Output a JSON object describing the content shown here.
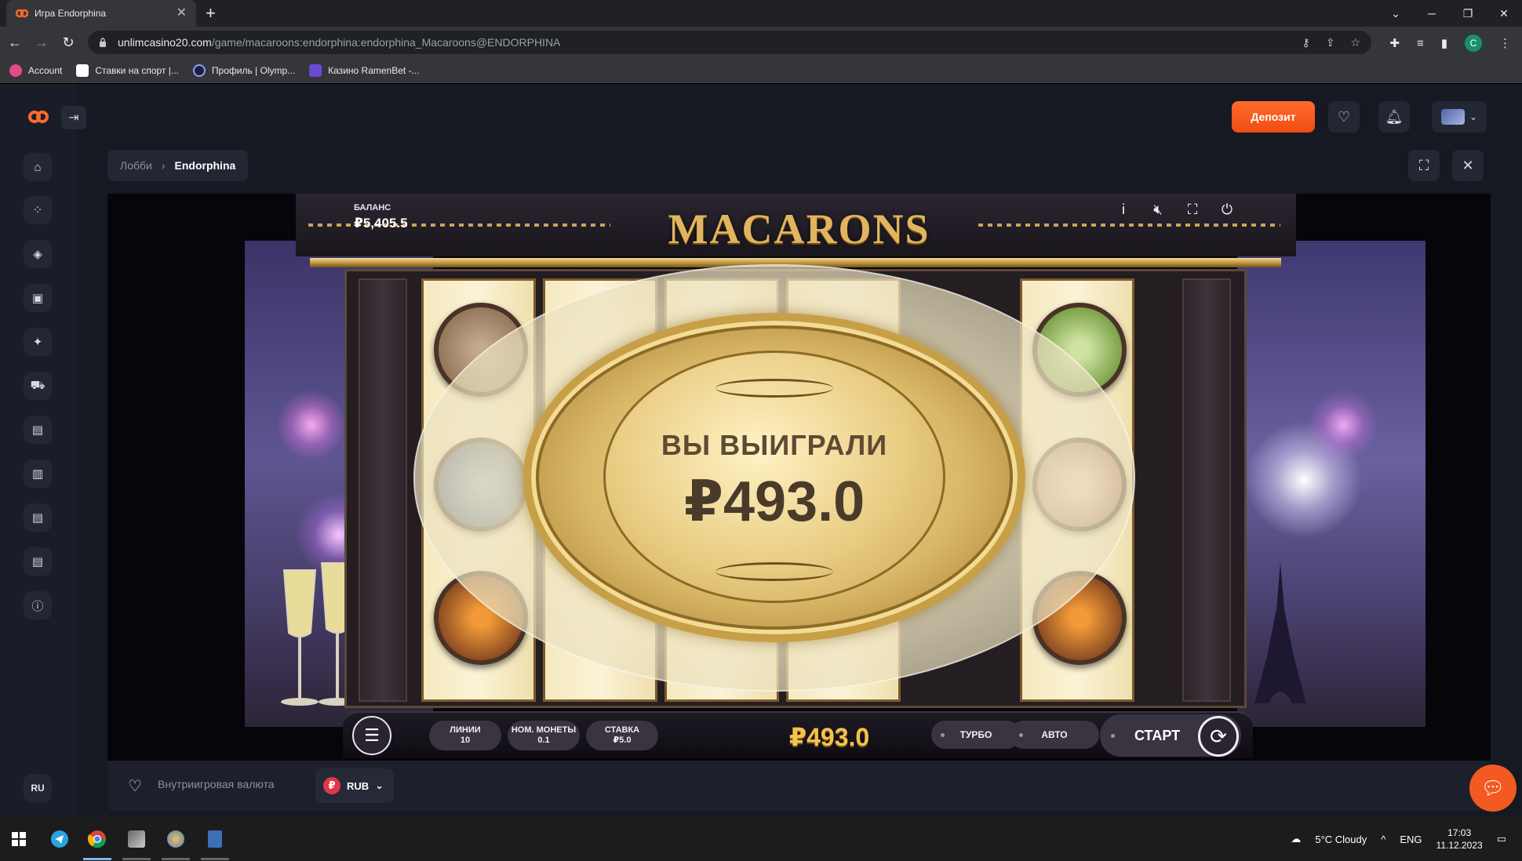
{
  "browser": {
    "tab_title": "Игра Endorphina",
    "url_host": "unlimcasino20.com",
    "url_path": "/game/macaroons:endorphina:endorphina_Macaroons@ENDORPHINA",
    "profile_initial": "C",
    "bookmarks": [
      {
        "label": "Account",
        "color": "#e24a8a"
      },
      {
        "label": "Ставки на спорт |...",
        "color": "#ffffff"
      },
      {
        "label": "Профиль | Olymp...",
        "color": "#8aa0ff"
      },
      {
        "label": "Казино RamenBet -...",
        "color": "#6a4bd0"
      }
    ]
  },
  "site": {
    "deposit_label": "Депозит",
    "lang_label": "RU",
    "breadcrumb": {
      "lobby": "Лобби",
      "current": "Endorphina"
    },
    "footer": {
      "currency_label": "Внутриигровая валюта",
      "currency_code": "RUB"
    },
    "sidebar_icons": [
      "home-icon",
      "grid-icon",
      "casino-chip-icon",
      "ticket-icon",
      "sparkle-icon",
      "car-icon",
      "document-icon",
      "wallet-icon",
      "document-icon",
      "document-icon",
      "info-icon"
    ]
  },
  "game": {
    "title": "MACARONS",
    "balance_label": "БАЛАНС",
    "balance_value": "₽5,405.5",
    "win_label": "ВЫ ВЫИГРАЛИ",
    "win_amount": "₽493.0",
    "win_total": "₽493.0",
    "lines_label": "ЛИНИИ",
    "lines_value": "10",
    "coin_label": "НОМ. МОНЕТЫ",
    "coin_value": "0.1",
    "bet_label": "СТАВКА",
    "bet_value": "₽5.0",
    "turbo_label": "ТУРБО",
    "auto_label": "АВТО",
    "start_label": "СТАРТ",
    "info_icon_text": "i"
  },
  "taskbar": {
    "weather": "5°C  Cloudy",
    "lang": "ENG",
    "time": "17:03",
    "date": "11.12.2023"
  }
}
